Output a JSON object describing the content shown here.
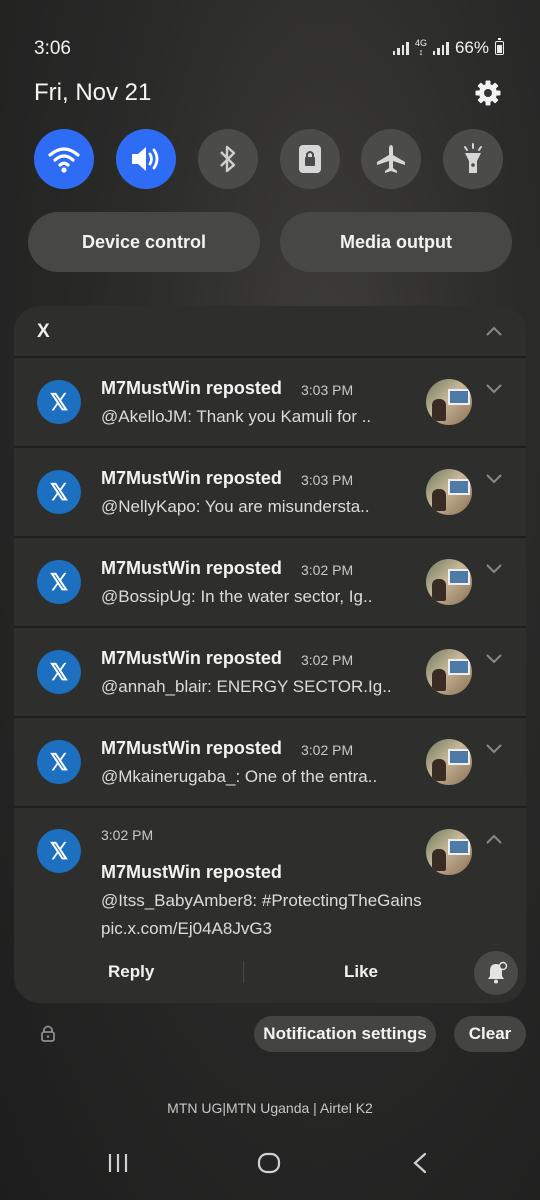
{
  "status_bar": {
    "time": "3:06",
    "network": "4G",
    "battery": "66%"
  },
  "date": "Fri, Nov 21",
  "quick_settings": [
    {
      "name": "wifi",
      "active": true
    },
    {
      "name": "sound",
      "active": true
    },
    {
      "name": "bluetooth",
      "active": false
    },
    {
      "name": "rotation-lock",
      "active": false
    },
    {
      "name": "airplane-mode",
      "active": false
    },
    {
      "name": "flashlight",
      "active": false
    }
  ],
  "pills": {
    "device_control": "Device control",
    "media_output": "Media output"
  },
  "notification_group": {
    "app": "X",
    "items": [
      {
        "title": "M7MustWin reposted",
        "time": "3:03 PM",
        "text": "@AkelloJM: Thank you Kamuli for .."
      },
      {
        "title": "M7MustWin reposted",
        "time": "3:03 PM",
        "text": "@NellyKapo: You are misundersta.."
      },
      {
        "title": "M7MustWin reposted",
        "time": "3:02 PM",
        "text": "@BossipUg: In the water sector, Ig.."
      },
      {
        "title": "M7MustWin reposted",
        "time": "3:02 PM",
        "text": "@annah_blair: ENERGY SECTOR.Ig.."
      },
      {
        "title": "M7MustWin reposted",
        "time": "3:02 PM",
        "text": "@Mkainerugaba_: One of the entra.."
      }
    ],
    "expanded": {
      "time": "3:02 PM",
      "title": "M7MustWin reposted",
      "line1": "@Itss_BabyAmber8: #ProtectingTheGains",
      "line2": "pic.x.com/Ej04A8JvG3",
      "reply": "Reply",
      "like": "Like"
    }
  },
  "footer": {
    "notification_settings": "Notification settings",
    "clear": "Clear",
    "carrier": "MTN UG|MTN Uganda | Airtel K2"
  },
  "colors": {
    "accent": "#2f6cf5",
    "x_badge": "#1d6fc0"
  }
}
